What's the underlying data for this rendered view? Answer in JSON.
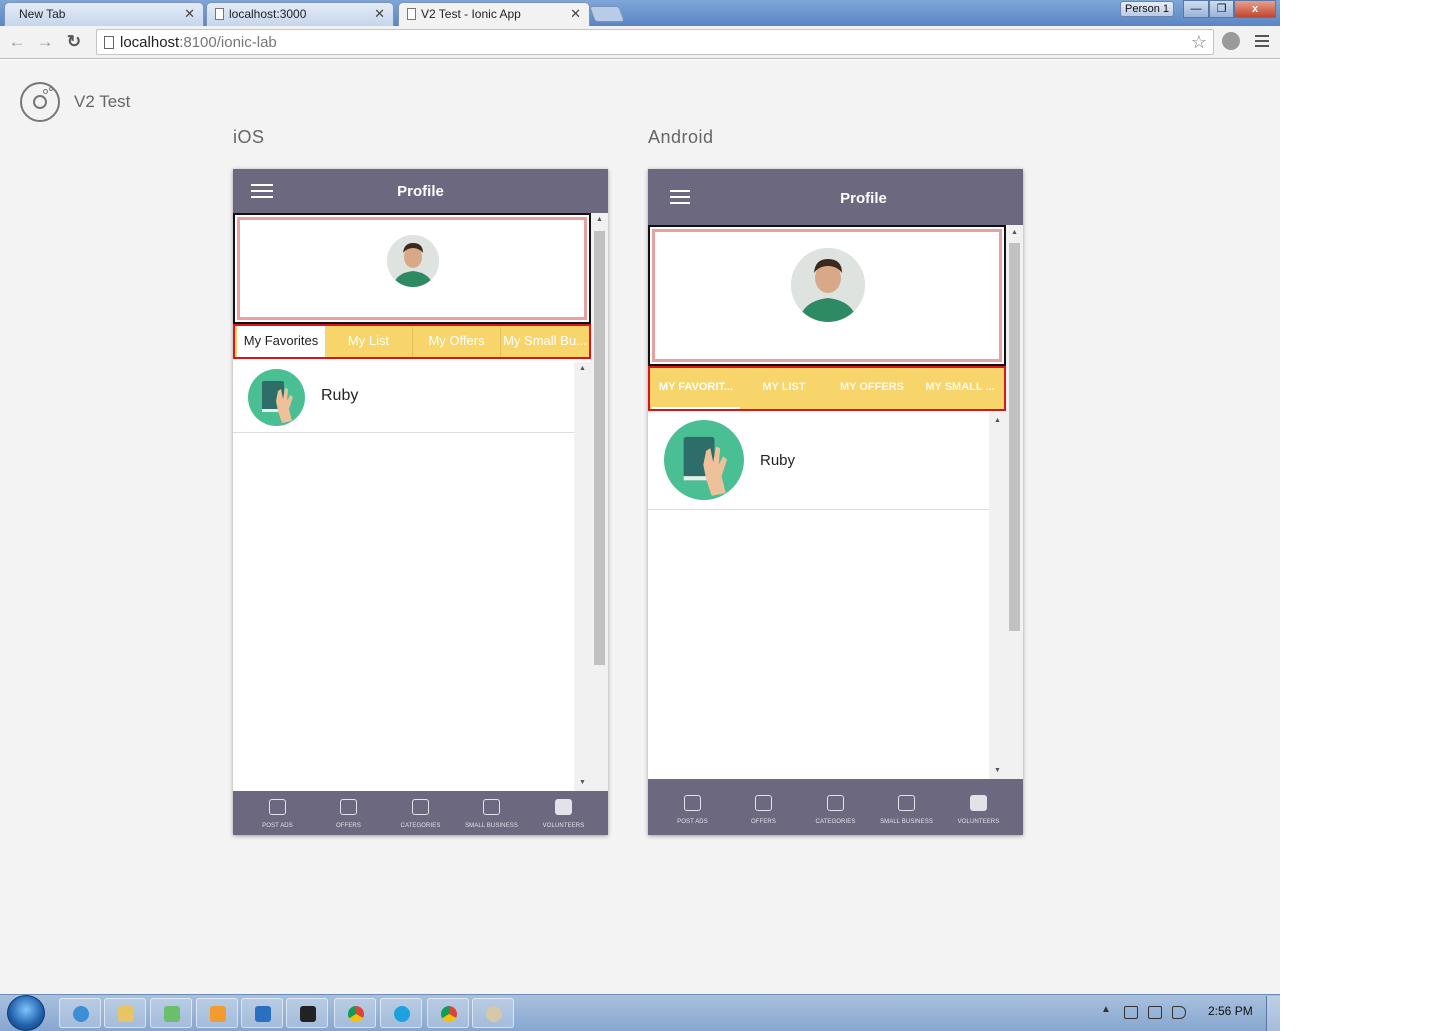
{
  "browser": {
    "tabs": [
      {
        "label": "New Tab",
        "active": false
      },
      {
        "label": "localhost:3000",
        "active": false
      },
      {
        "label": "V2 Test - Ionic App",
        "active": true
      }
    ],
    "profile_button": "Person 1",
    "window_controls": {
      "minimize": "—",
      "maximize": "❐",
      "close": "x"
    },
    "address": {
      "host": "localhost",
      "rest": ":8100/ionic-lab"
    }
  },
  "lab": {
    "app_title": "V2 Test",
    "platforms": [
      {
        "label": "iOS",
        "navbar_title": "Profile",
        "segments": [
          "My Favorites",
          "My List",
          "My Offers",
          "My Small Bu..."
        ],
        "selected_segment": 0,
        "list_items": [
          {
            "label": "Ruby"
          }
        ]
      },
      {
        "label": "Android",
        "navbar_title": "Profile",
        "segments": [
          "MY FAVORIT...",
          "MY LIST",
          "MY OFFERS",
          "MY SMALL ..."
        ],
        "selected_segment": 0,
        "list_items": [
          {
            "label": "Ruby"
          }
        ]
      }
    ],
    "bottom_tabs": [
      {
        "label": "POST ADS",
        "icon": "trophy-icon"
      },
      {
        "label": "OFFERS",
        "icon": "offers-icon"
      },
      {
        "label": "CATEGORIES",
        "icon": "cart-icon"
      },
      {
        "label": "SMALL BUSINESS",
        "icon": "bus-icon"
      },
      {
        "label": "VOLUNTEERS",
        "icon": "volunteers-icon"
      }
    ]
  },
  "taskbar": {
    "clock": "2:56 PM",
    "apps": [
      "internet-explorer-icon",
      "file-explorer-icon",
      "photo-viewer-icon",
      "media-player-icon",
      "visual-studio-code-icon",
      "command-prompt-icon",
      "chrome-icon",
      "skype-icon",
      "chrome-canary-icon",
      "paint-icon"
    ]
  },
  "colors": {
    "navbar": "#6b6880",
    "segment_bg": "#f7d56b",
    "segment_border": "#d9141e",
    "card_border_outer": "#111111",
    "card_border_inner": "#e8a0a0",
    "icon_circle": "#4bbf94"
  }
}
